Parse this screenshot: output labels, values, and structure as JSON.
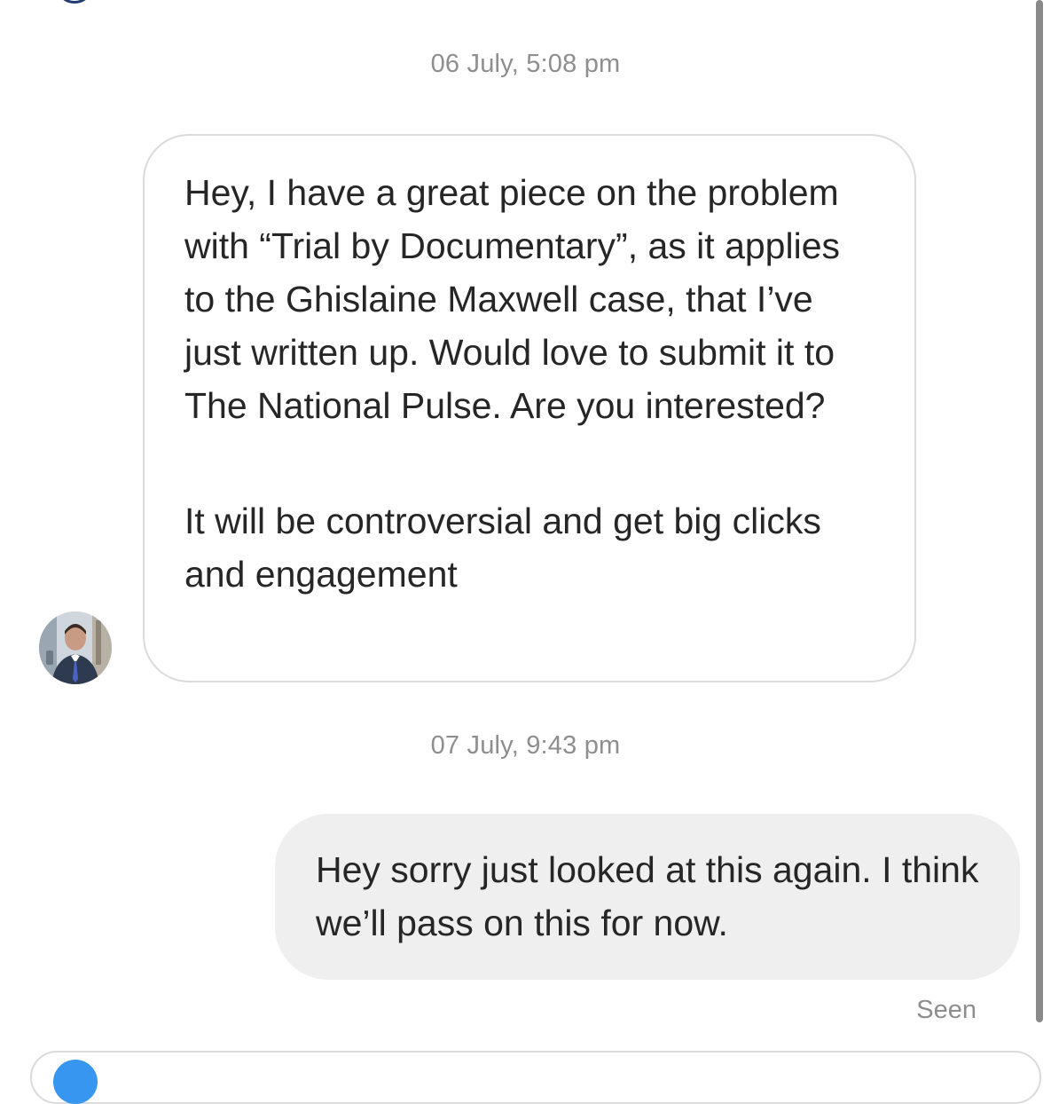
{
  "conversation": {
    "timestamps": [
      "06 July, 5:08 pm",
      "07 July, 9:43 pm"
    ],
    "incoming_message": {
      "paragraph_1": "Hey, I have a great piece on the problem with “Trial by Documentary”, as it applies to the Ghislaine Maxwell case, that I’ve just written up. Would love to submit it to The National Pulse. Are you interested?",
      "paragraph_2": "It will be controversial and get big clicks and engagement"
    },
    "outgoing_message": {
      "text": "Hey sorry just looked at this again. I think we’ll pass on this for now."
    },
    "status": "Seen"
  },
  "icons": {
    "avatar": "profile-photo",
    "composer": "camera-icon"
  },
  "colors": {
    "timestamp_text": "#8e8e8e",
    "incoming_border": "#dbdbdb",
    "outgoing_background": "#efefef",
    "message_text": "#262626",
    "composer_accent": "#3797f0"
  }
}
